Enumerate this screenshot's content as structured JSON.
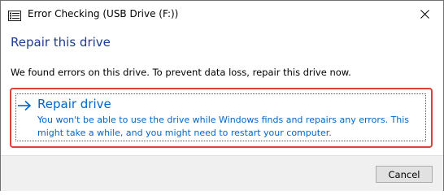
{
  "window": {
    "title": "Error Checking (USB Drive (F:))",
    "app_icon": "drive-check-icon",
    "close_icon": "close-icon"
  },
  "main": {
    "heading": "Repair this drive",
    "message": "We found errors on this drive. To prevent data loss, repair this drive now."
  },
  "option": {
    "icon": "arrow-right-icon",
    "title": "Repair drive",
    "description": "You won't be able to use the drive while Windows finds and repairs any errors. This might take a while, and you might need to restart your computer."
  },
  "footer": {
    "cancel_label": "Cancel"
  },
  "colors": {
    "heading": "#1c3c8c",
    "link": "#0066cc",
    "highlight_border": "#e0403a",
    "footer_bg": "#f0f0f0"
  }
}
